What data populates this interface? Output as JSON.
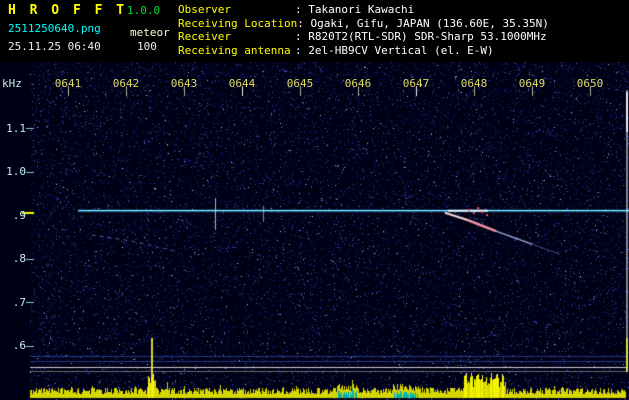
{
  "app": {
    "title": "H R O F F T",
    "version": "1.0.0",
    "filename": "2511250640.png",
    "mode": "meteor",
    "datetime": "25.11.25 06:40",
    "level": "100"
  },
  "station": {
    "rows": [
      {
        "label": "Observer",
        "value": ": Takanori Kawachi"
      },
      {
        "label": "Receiving Location",
        "value": ": Ogaki, Gifu, JAPAN (136.60E, 35.35N)"
      },
      {
        "label": "Receiver",
        "value": ": R820T2(RTL-SDR) SDR-Sharp 53.1000MHz"
      },
      {
        "label": "Receiving antenna",
        "value": ": 2el-HB9CV Vertical (el. E-W)"
      }
    ]
  },
  "spectrogram": {
    "y_unit": "kHz",
    "freq_labels": [
      "1.1",
      "1.0",
      ".9",
      ".8",
      ".7",
      ".6"
    ],
    "freq_values": [
      1.1,
      1.0,
      0.9,
      0.8,
      0.7,
      0.6
    ],
    "time_labels": [
      "0641",
      "0642",
      "0643",
      "0644",
      "0645",
      "0646",
      "0647",
      "0648",
      "0649",
      "0650"
    ],
    "carrier_khz": 0.91,
    "echoes": [
      {
        "points": [
          [
            7.5,
            0.905
          ],
          [
            7.9,
            0.888
          ],
          [
            8.38,
            0.863
          ],
          [
            9.0,
            0.833
          ],
          [
            9.48,
            0.81
          ]
        ],
        "seg_colors": [
          "rgba(255,230,230,0.95)",
          "rgba(255,150,170,0.95)",
          "rgba(190,215,255,0.8)",
          "rgba(135,170,255,0.45)"
        ],
        "seg_widths": [
          2,
          2.5,
          1.5,
          1
        ],
        "dashed": false
      },
      {
        "points": [
          [
            1.41,
            0.854
          ],
          [
            2.1,
            0.84
          ],
          [
            2.86,
            0.817
          ]
        ],
        "seg_colors": [
          "rgba(150,180,255,0.55)",
          "rgba(150,180,255,0.45)"
        ],
        "seg_widths": [
          1,
          1
        ],
        "dashed": true
      }
    ],
    "colors": {
      "noise_bg": "#000014",
      "carrier": "#78f2ff",
      "carrier_glow": "rgba(70,150,255,0.3)",
      "amplitude_bar": "#d6d600",
      "amplitude_alt": "#00b4b4",
      "tick": "#ffff00"
    }
  }
}
